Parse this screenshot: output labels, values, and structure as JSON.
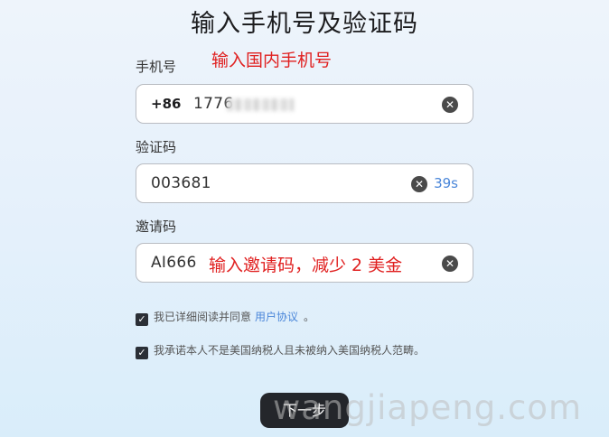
{
  "page": {
    "title": "输入手机号及验证码"
  },
  "phone": {
    "label": "手机号",
    "annotation": "输入国内手机号",
    "country_code": "+86",
    "value_visible": "1776"
  },
  "verification": {
    "label": "验证码",
    "value": "003681",
    "countdown": "39s"
  },
  "invite": {
    "label": "邀请码",
    "value": "AI666",
    "annotation": "输入邀请码，减少 2 美金"
  },
  "agreements": [
    {
      "checked": true,
      "text_before": "我已详细阅读并同意",
      "link": "用户协议",
      "text_after": "。"
    },
    {
      "checked": true,
      "text_before": "我承诺本人不是美国纳税人且未被纳入美国纳税人范畴。"
    }
  ],
  "actions": {
    "next_label": "下一步"
  },
  "watermark": "wangjiapeng.com",
  "icons": {
    "clear": "clear-icon",
    "checkbox": "checkbox-checked-icon"
  },
  "colors": {
    "annotation": "#e02020",
    "link": "#4a86d9",
    "primary_button": "#24262b"
  }
}
